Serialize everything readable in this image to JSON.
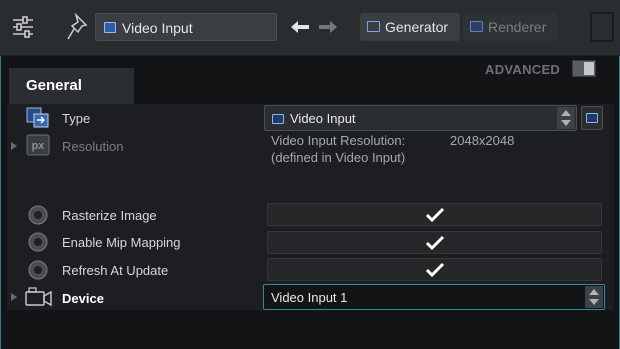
{
  "toolbar": {
    "node_name": "Video Input",
    "tabs": [
      {
        "label": "Generator",
        "active": true
      },
      {
        "label": "Renderer",
        "active": false
      }
    ]
  },
  "panel": {
    "tab_label": "General",
    "advanced_label": "ADVANCED",
    "advanced_enabled": false
  },
  "properties": {
    "type": {
      "label": "Type",
      "value": "Video Input"
    },
    "resolution": {
      "label": "Resolution",
      "info_label": "Video Input Resolution:",
      "info_value": "2048x2048",
      "info_note": "(defined in Video Input)"
    },
    "rasterize": {
      "label": "Rasterize Image",
      "checked": true
    },
    "mipmapping": {
      "label": "Enable Mip Mapping",
      "checked": true
    },
    "refresh": {
      "label": "Refresh At Update",
      "checked": true
    },
    "device": {
      "label": "Device",
      "value": "Video Input 1"
    }
  },
  "colors": {
    "accent": "#2f8fa0",
    "background": "#121416",
    "toolbar": "#2a2d30"
  }
}
